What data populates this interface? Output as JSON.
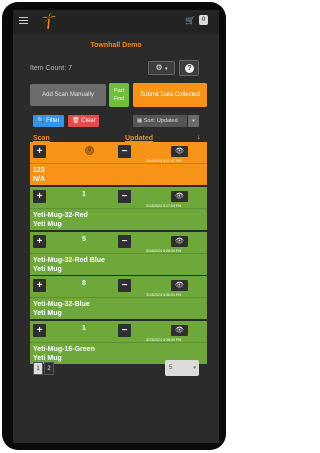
{
  "header": {
    "cart_count": "0"
  },
  "page_title": "Townhall Demo",
  "item_count": "Item Count: 7",
  "actions": {
    "add_scan": "Add Scan Manually",
    "part_find_1": "Part",
    "part_find_2": "Find",
    "submit": "Submit Data Collected",
    "filter": "Filter",
    "clear": "Clear",
    "sort": "Sort: Updated"
  },
  "table": {
    "col_scan": "Scan",
    "col_updated": "Updated"
  },
  "rows": [
    {
      "qty": "0",
      "date": "3/14/2024 5:17:47 PM",
      "line1": "123",
      "line2": "N/A",
      "status": "orange"
    },
    {
      "qty": "1",
      "date": "3/14/2024 5:17:04 PM",
      "line1": "Yeti-Mug-32-Red",
      "line2": "Yeti Mug",
      "status": "green"
    },
    {
      "qty": "5",
      "date": "3/14/2024 5:28:36 PM",
      "line1": "Yeti-Mug-32-Red Blue",
      "line2": "Yeti Mug",
      "status": "green"
    },
    {
      "qty": "8",
      "date": "3/13/2024 5:38:51 PM",
      "line1": "Yeti-Mug-32-Blue",
      "line2": "Yeti Mug",
      "status": "green"
    },
    {
      "qty": "1",
      "date": "3/13/2024 5:38:58 PM",
      "line1": "Yeti-Mug-16-Green",
      "line2": "Yeti Mug",
      "status": "green"
    }
  ],
  "pagination": {
    "pages": [
      "1",
      "2"
    ],
    "page_size": "5"
  }
}
